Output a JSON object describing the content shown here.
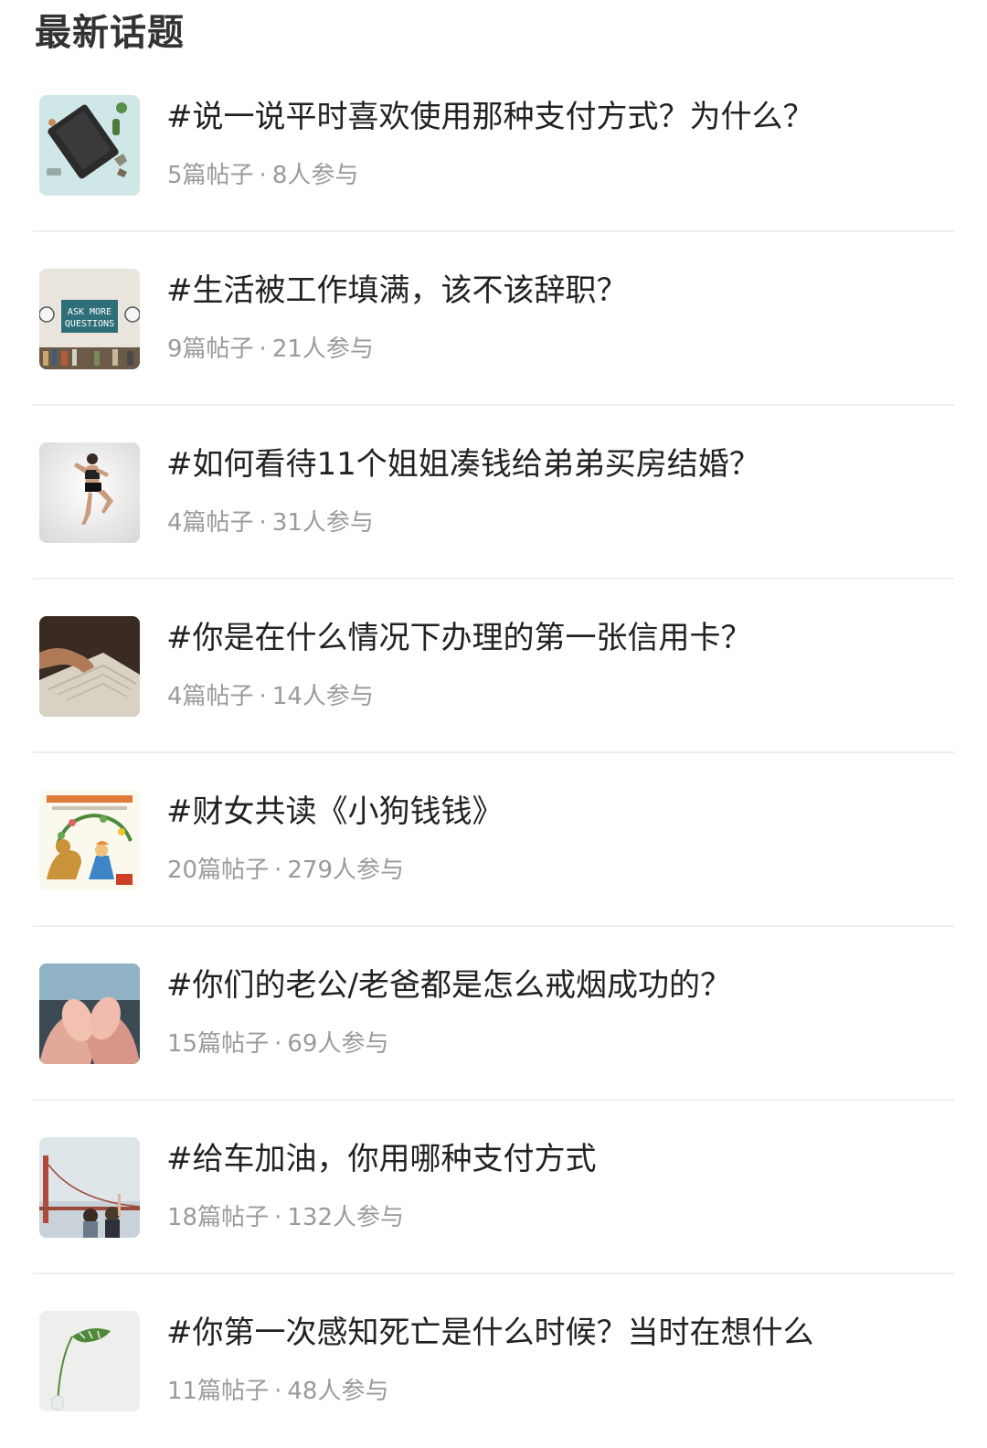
{
  "page": {
    "title": "最新话题"
  },
  "topics": [
    {
      "title": "#说一说平时喜欢使用那种支付方式？为什么？",
      "posts": "5篇帖子",
      "separator": "·",
      "participants": "8人参与",
      "thumbnail": "notebook-flatlay-thumbnail"
    },
    {
      "title": "#生活被工作填满，该不该辞职？",
      "posts": "9篇帖子",
      "separator": "·",
      "participants": "21人参与",
      "thumbnail": "ask-more-questions-sign-thumbnail",
      "thumbnail_text": "ASK MORE QUESTIONS"
    },
    {
      "title": "#如何看待11个姐姐凑钱给弟弟买房结婚？",
      "posts": "4篇帖子",
      "separator": "·",
      "participants": "31人参与",
      "thumbnail": "jumping-runner-thumbnail"
    },
    {
      "title": "#你是在什么情况下办理的第一张信用卡？",
      "posts": "4篇帖子",
      "separator": "·",
      "participants": "14人参与",
      "thumbnail": "reading-book-thumbnail"
    },
    {
      "title": "#财女共读《小狗钱钱》",
      "posts": "20篇帖子",
      "separator": "·",
      "participants": "279人参与",
      "thumbnail": "book-cover-dog-girl-thumbnail"
    },
    {
      "title": "#你们的老公/老爸都是怎么戒烟成功的？",
      "posts": "15篇帖子",
      "separator": "·",
      "participants": "69人参与",
      "thumbnail": "baby-feet-in-hands-thumbnail"
    },
    {
      "title": "#给车加油，你用哪种支付方式",
      "posts": "18篇帖子",
      "separator": "·",
      "participants": "132人参与",
      "thumbnail": "bridge-people-thumbnail"
    },
    {
      "title": "#你第一次感知死亡是什么时候？当时在想什么",
      "posts": "11篇帖子",
      "separator": "·",
      "participants": "48人参与",
      "thumbnail": "plant-in-vase-thumbnail"
    }
  ],
  "colors": {
    "title_text": "#222222",
    "meta_text": "#9a9a9a",
    "divider": "#eeeeee",
    "heading": "#333333"
  }
}
